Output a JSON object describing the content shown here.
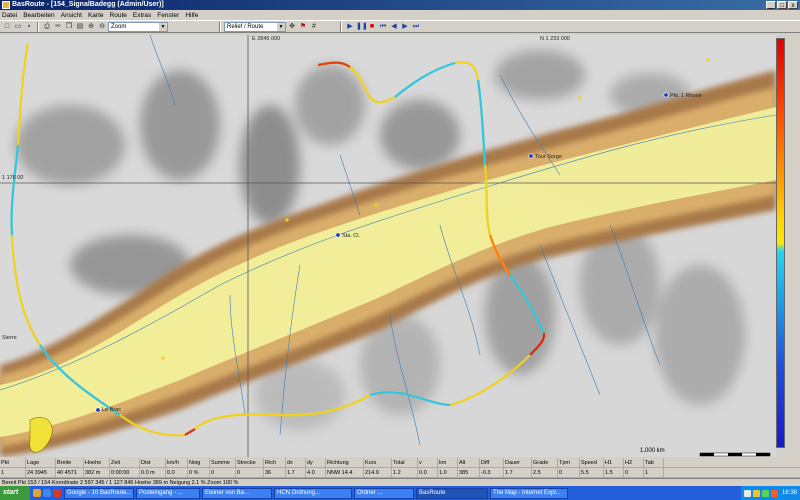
{
  "window": {
    "title": "BasRoute - [154_SignalBadegg (Admin/User)]",
    "buttons": [
      "_",
      "□",
      "x"
    ]
  },
  "menu": [
    "Datei",
    "Bearbeiten",
    "Ansicht",
    "Karte",
    "Route",
    "Extras",
    "Fenster",
    "Hilfe"
  ],
  "toolbar": {
    "zoom_select": "Zoom",
    "layer_select": "Relief / Route",
    "icons": [
      "new-icon",
      "open-icon",
      "save-icon",
      "print-icon",
      "cut-icon",
      "copy-icon",
      "paste-icon",
      "zoom-in-icon",
      "zoom-out-icon",
      "pan-icon",
      "flag-icon",
      "play-icon",
      "pause-icon",
      "stop-icon",
      "first-icon",
      "prev-icon",
      "next-icon",
      "last-icon"
    ]
  },
  "map": {
    "labels": {
      "grid_top": "E 2845 000",
      "top_right": "N 1 233 000",
      "left_grid": "1 176 00",
      "left_low": "Sierre",
      "point_a": "Pkt. 1 Rhone",
      "point_b": "Tour Sorge",
      "point_c": "Sta. Cl.",
      "point_d": "Le Brac",
      "scale": "1,000 km"
    },
    "colorbar": [
      "#e00000",
      "#ff4a00",
      "#ff9a00",
      "#ffd400",
      "#25d4f0",
      "#1ba0e8",
      "#2050e0",
      "#1a18c8"
    ]
  },
  "status": {
    "headers": [
      "Pkt",
      "Lage",
      "Breite",
      "Hoehe",
      "Zeit",
      "Dist",
      "km/h",
      "Neig",
      "Summe",
      "Strecke",
      "Rich",
      "dx",
      "dy",
      "Richtung",
      "Kurs",
      "Total",
      "v",
      "km",
      "Alt",
      "Diff",
      "Dauer",
      "Grade",
      "Tpm",
      "Speed",
      "H1",
      "H2",
      "Tab"
    ],
    "values": [
      "1",
      "24 3945",
      "40 4571",
      "382 m",
      "0:00:00",
      "0.0 m",
      "0.0",
      "0 %",
      "0",
      "0",
      "36",
      "1.7",
      "4.0",
      "NNW 14.4",
      "214.9",
      "1.2",
      "0.0",
      "1.0",
      "385",
      "-0.3",
      "1.7",
      "2.5",
      "0",
      "5.5",
      "1.5",
      "0",
      "1"
    ],
    "line": "Bereit   Pkt 153 / 154   Koordinate 2 597 345 / 1 127 845   Hoehe 389 m   Neigung 2.1 %   Zoom 100 %"
  },
  "taskbar": {
    "start": "start",
    "tasks": [
      "Google - 10 BasRoute...",
      "Posteingang - ...",
      "Eleiner von Ba...",
      "HCN Ordnung...",
      "Ordner ...",
      "BasRoute",
      "The Map - Internet Expl..."
    ],
    "active_index": 5,
    "clock": "16:38"
  }
}
